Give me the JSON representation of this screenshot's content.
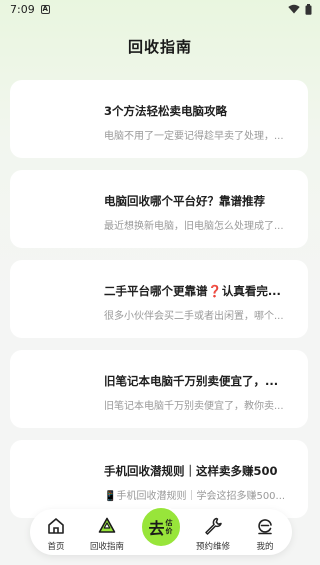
{
  "status": {
    "time": "7:09",
    "icon": "A"
  },
  "page": {
    "title": "回收指南"
  },
  "articles": [
    {
      "title": "3个方法轻松卖电脑攻略",
      "summary": "电脑不用了一定要记得趁早卖了处理，..."
    },
    {
      "title": "电脑回收哪个平台好？靠谱推荐",
      "summary": "最近想换新电脑，旧电脑怎么处理成了..."
    },
    {
      "title": "二手平台哪个更靠谱❓认真看完...",
      "summary": "很多小伙伴会买二手或者出闲置，哪个..."
    },
    {
      "title": "旧笔记本电脑千万别卖便宜了，...",
      "summary": "旧笔记本电脑千万别卖便宜了，教你卖..."
    },
    {
      "title": "手机回收潜规则｜这样卖多赚500",
      "summary": "📱手机回收潜规则｜学会这招多赚500..."
    }
  ],
  "tabs": {
    "home": "首页",
    "guide": "回收指南",
    "center_main": "去",
    "center_sub": "估价",
    "repair": "预约维修",
    "mine": "我的"
  },
  "colors": {
    "accent": "#98e53a",
    "card": "#ffffff",
    "background": "#f4f5f4"
  }
}
